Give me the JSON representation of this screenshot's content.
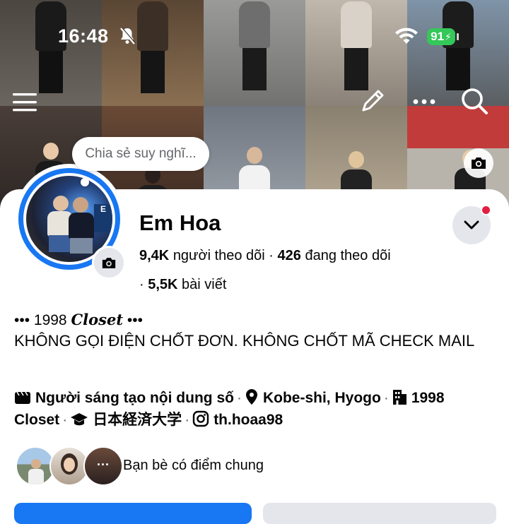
{
  "status_bar": {
    "time": "16:48",
    "battery": "91"
  },
  "cover": {
    "tile_colors": [
      "#5a5048",
      "#6b5a45",
      "#8a8a88",
      "#a69a8c",
      "#6f7e8c",
      "#3e3836",
      "#5c4030",
      "#6a7078",
      "#9a8e7a",
      "#b8b4ac"
    ]
  },
  "thought_bubble": {
    "placeholder": "Chia sẻ suy nghĩ..."
  },
  "profile": {
    "name": "Em Hoa",
    "followers_count": "9,4K",
    "followers_label": "người theo dõi",
    "following_count": "426",
    "following_label": "đang theo dõi",
    "posts_prefix": "·",
    "posts_count": "5,5K",
    "posts_label": "bài viết"
  },
  "bio": {
    "line1_prefix": "••• 1998",
    "line1_script": "Closet",
    "line1_suffix": "•••",
    "line2": "KHÔNG GỌI ĐIỆN CHỐT ĐƠN. KHÔNG CHỐT MÃ CHECK MAIL"
  },
  "details": {
    "category": "Người sáng tạo nội dung số",
    "location": "Kobe-shi, Hyogo",
    "workplace": "1998 Closet",
    "education": "日本経済大学",
    "instagram": "th.hoaa98",
    "separator": "·"
  },
  "friends": {
    "label": "Bạn bè có điểm chung"
  },
  "colors": {
    "accent": "#1877f2",
    "notification": "#e41e3f",
    "battery": "#34c759",
    "muted": "#65676b"
  }
}
